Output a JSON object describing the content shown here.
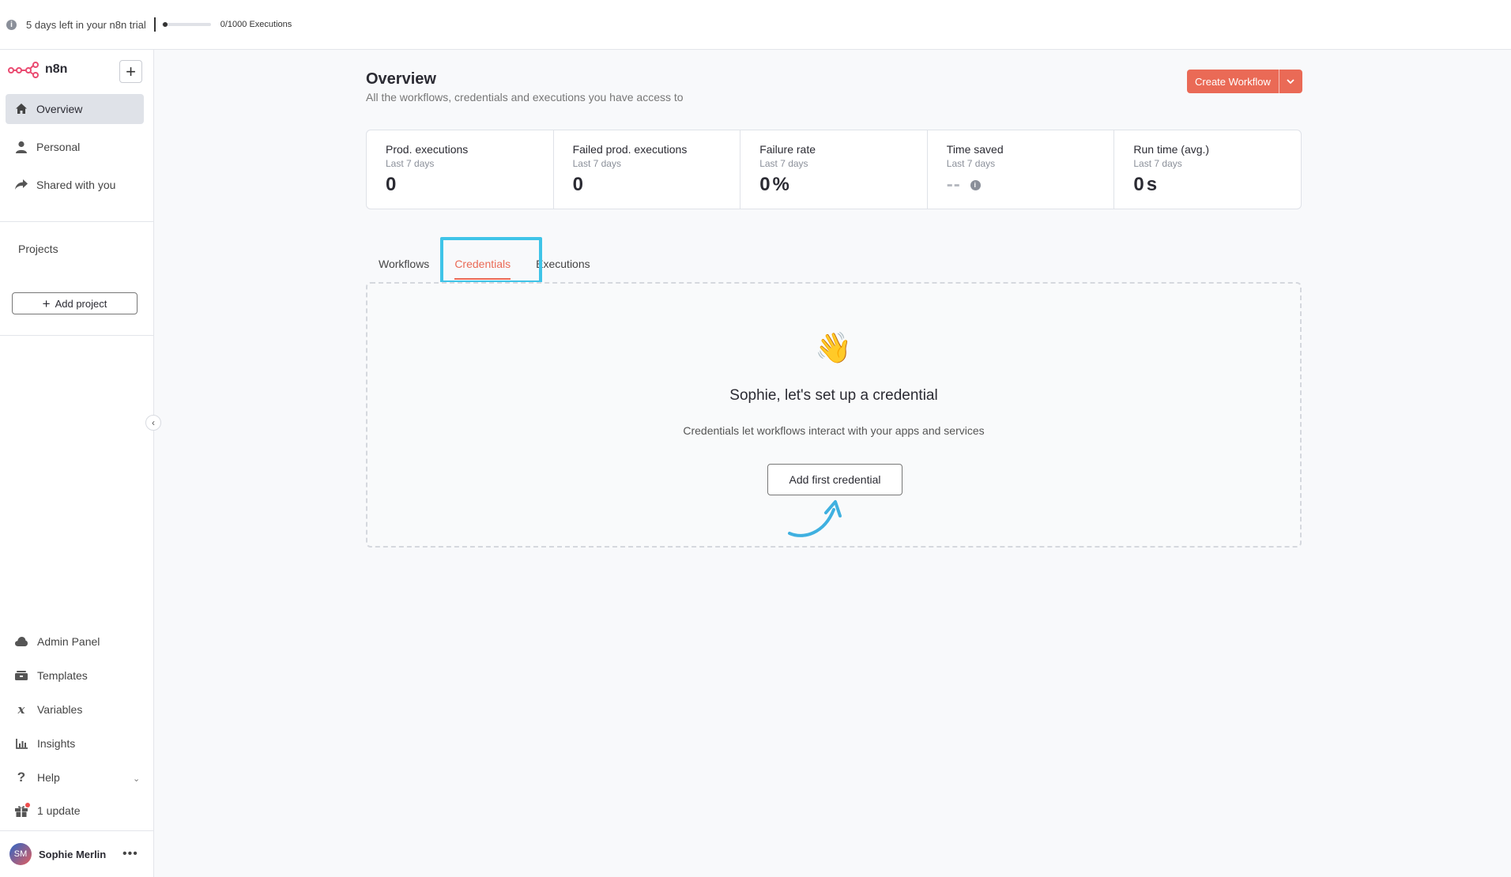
{
  "topbar": {
    "trial_text": "5 days left in your n8n trial",
    "executions_text": "0/1000 Executions",
    "executions_used_fraction": 0.0
  },
  "sidebar": {
    "brand": "n8n",
    "nav": [
      {
        "label": "Overview",
        "icon": "home-icon",
        "active": true
      },
      {
        "label": "Personal",
        "icon": "user-icon",
        "active": false
      },
      {
        "label": "Shared with you",
        "icon": "share-icon",
        "active": false
      }
    ],
    "projects_label": "Projects",
    "add_project_label": "Add project",
    "bottom": [
      {
        "label": "Admin Panel",
        "icon": "cloud-icon"
      },
      {
        "label": "Templates",
        "icon": "templates-icon"
      },
      {
        "label": "Variables",
        "icon": "variables-icon"
      },
      {
        "label": "Insights",
        "icon": "chart-icon"
      },
      {
        "label": "Help",
        "icon": "help-icon"
      },
      {
        "label": "1 update",
        "icon": "gift-icon"
      }
    ],
    "user": {
      "initials": "SM",
      "name": "Sophie Merlin"
    }
  },
  "main": {
    "title": "Overview",
    "subtitle": "All the workflows, credentials and executions you have access to",
    "create_label": "Create Workflow",
    "stats": [
      {
        "title": "Prod. executions",
        "period": "Last 7 days",
        "value": "0",
        "unit": ""
      },
      {
        "title": "Failed prod. executions",
        "period": "Last 7 days",
        "value": "0",
        "unit": ""
      },
      {
        "title": "Failure rate",
        "period": "Last 7 days",
        "value": "0",
        "unit": "%"
      },
      {
        "title": "Time saved",
        "period": "Last 7 days",
        "value": "--",
        "unit": ""
      },
      {
        "title": "Run time (avg.)",
        "period": "Last 7 days",
        "value": "0",
        "unit": "s"
      }
    ],
    "tabs": [
      {
        "label": "Workflows",
        "active": false
      },
      {
        "label": "Credentials",
        "active": true
      },
      {
        "label": "Executions",
        "active": false
      }
    ],
    "empty": {
      "emoji": "👋",
      "title": "Sophie, let's set up a credential",
      "description": "Credentials let workflows interact with your apps and services",
      "button_label": "Add first credential"
    }
  },
  "colors": {
    "accent": "#ea6a56",
    "highlight": "#3fc4e8",
    "arrow": "#3fb0e0"
  }
}
